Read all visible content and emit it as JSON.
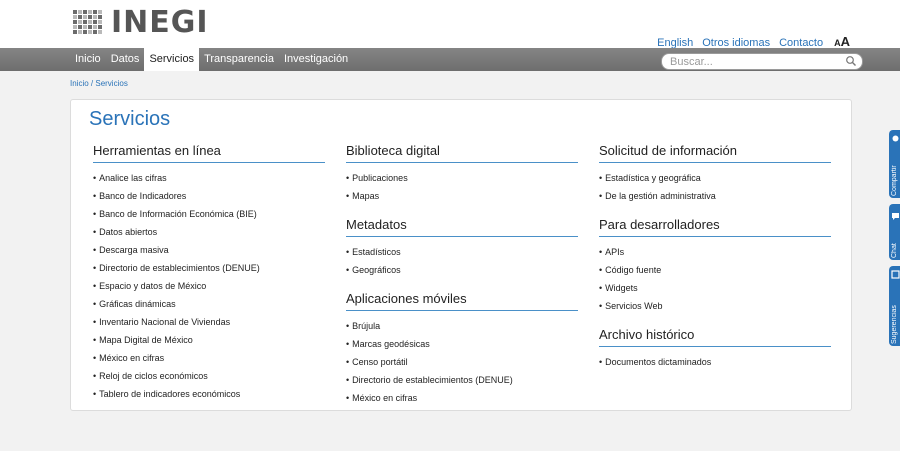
{
  "brand": {
    "name": "INEGI"
  },
  "toplinks": {
    "english": "English",
    "other_languages": "Otros idiomas",
    "contact": "Contacto",
    "font_size": "AA"
  },
  "nav": {
    "items": [
      "Inicio",
      "Datos",
      "Servicios",
      "Transparencia",
      "Investigación"
    ],
    "active": "Servicios"
  },
  "search": {
    "placeholder": "Buscar..."
  },
  "breadcrumb": {
    "home": "Inicio",
    "separator": " / ",
    "current": "Servicios"
  },
  "page": {
    "title": "Servicios",
    "columns": [
      {
        "sections": [
          {
            "heading": "Herramientas en línea",
            "items": [
              "Analice las cifras",
              "Banco de Indicadores",
              "Banco de Información Económica (BIE)",
              "Datos abiertos",
              "Descarga masiva",
              "Directorio de establecimientos (DENUE)",
              "Espacio y datos de México",
              "Gráficas dinámicas",
              "Inventario Nacional de Viviendas",
              "Mapa Digital de México",
              "México en cifras",
              "Reloj de ciclos económicos",
              "Tablero de indicadores económicos"
            ]
          }
        ]
      },
      {
        "sections": [
          {
            "heading": "Biblioteca digital",
            "items": [
              "Publicaciones",
              "Mapas"
            ]
          },
          {
            "heading": "Metadatos",
            "items": [
              "Estadísticos",
              "Geográficos"
            ]
          },
          {
            "heading": "Aplicaciones móviles",
            "items": [
              "Brújula",
              "Marcas geodésicas",
              "Censo portátil",
              "Directorio de establecimientos (DENUE)",
              "México en cifras"
            ]
          }
        ]
      },
      {
        "sections": [
          {
            "heading": "Solicitud de información",
            "items": [
              "Estadística y geográfica",
              "De la gestión administrativa"
            ]
          },
          {
            "heading": "Para desarrolladores",
            "items": [
              "APIs",
              "Código fuente",
              "Widgets",
              "Servicios Web"
            ]
          },
          {
            "heading": "Archivo histórico",
            "items": [
              "Documentos dictaminados"
            ]
          }
        ]
      }
    ]
  },
  "side_tabs": [
    {
      "label": "Compartir",
      "icon": "share-icon"
    },
    {
      "label": "Chat",
      "icon": "chat-icon"
    },
    {
      "label": "Sugerencias",
      "icon": "suggestions-icon"
    }
  ],
  "colors": {
    "accent": "#2a73b8",
    "navbar": "#7a7a7a",
    "background": "#f2f2f2"
  }
}
